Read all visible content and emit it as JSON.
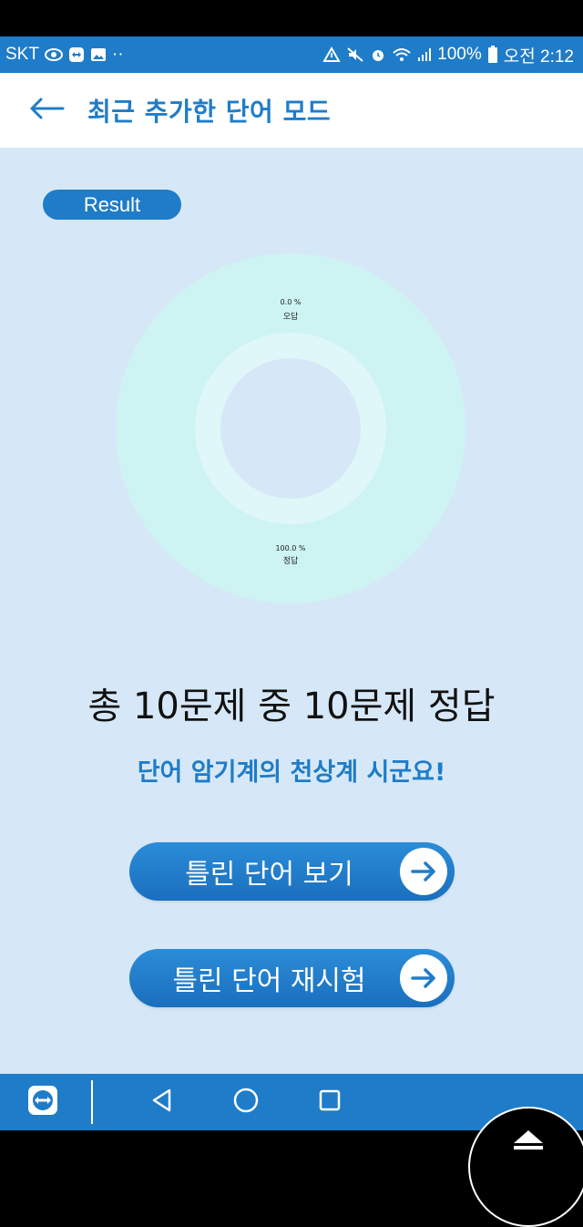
{
  "status_bar": {
    "carrier": "SKT",
    "dots": "··",
    "battery": "100%",
    "time": "오전 2:12"
  },
  "app_bar": {
    "title": "최근 추가한 단어 모드"
  },
  "result_badge": "Result",
  "chart_data": {
    "type": "pie",
    "slices": [
      {
        "label": "오답",
        "value": 0.0,
        "display": "0.0 %"
      },
      {
        "label": "정답",
        "value": 100.0,
        "display": "100.0 %"
      }
    ],
    "colors": {
      "outer": "#cdf4f2",
      "middle": "#dff7f8",
      "inner": "#d6e8f7"
    }
  },
  "summary": {
    "score_text": "총 10문제 중 10문제 정답",
    "message": "단어 암기계의 천상계 시군요!"
  },
  "buttons": {
    "view_wrong": "틀린 단어 보기",
    "retest_wrong": "틀린 단어 재시험"
  },
  "icons": {
    "back": "arrow-left-icon",
    "arrow": "arrow-right-icon",
    "nav_back": "triangle-back-icon",
    "nav_home": "circle-home-icon",
    "nav_recent": "square-recent-icon",
    "teamviewer": "teamviewer-icon",
    "eject": "eject-icon"
  },
  "theme": {
    "primary": "#1f7cc8",
    "background": "#d6e8f7"
  }
}
